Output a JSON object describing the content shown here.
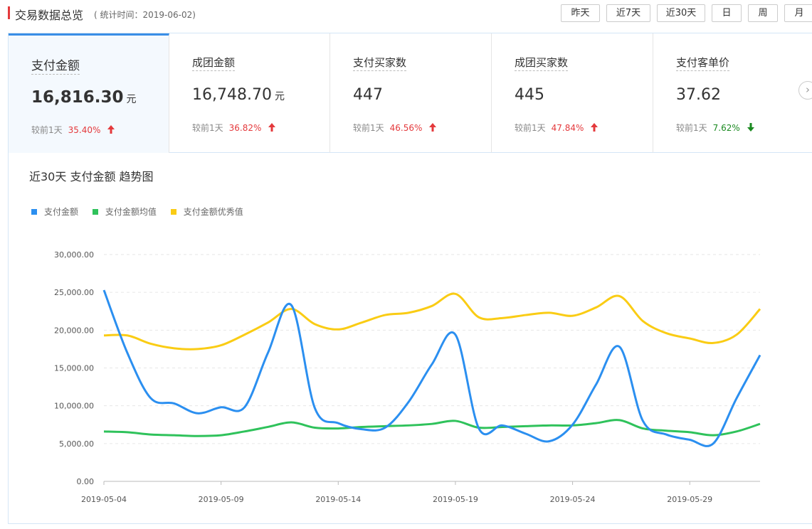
{
  "header": {
    "title": "交易数据总览",
    "subtitle": "( 统计时间：2019-06-02)"
  },
  "range_buttons": [
    {
      "label": "昨天",
      "active": true
    },
    {
      "label": "近7天",
      "active": false
    },
    {
      "label": "近30天",
      "active": false
    },
    {
      "label": "日",
      "active": false
    },
    {
      "label": "周",
      "active": false
    },
    {
      "label": "月",
      "active": false
    }
  ],
  "kpis": [
    {
      "name": "支付金额",
      "value": "16,816.30",
      "unit": "元",
      "compare_label": "较前1天",
      "change": "35.40%",
      "direction": "up",
      "active": true
    },
    {
      "name": "成团金额",
      "value": "16,748.70",
      "unit": "元",
      "compare_label": "较前1天",
      "change": "36.82%",
      "direction": "up",
      "active": false
    },
    {
      "name": "支付买家数",
      "value": "447",
      "unit": "",
      "compare_label": "较前1天",
      "change": "46.56%",
      "direction": "up",
      "active": false
    },
    {
      "name": "成团买家数",
      "value": "445",
      "unit": "",
      "compare_label": "较前1天",
      "change": "47.84%",
      "direction": "up",
      "active": false
    },
    {
      "name": "支付客单价",
      "value": "37.62",
      "unit": "",
      "compare_label": "较前1天",
      "change": "7.62%",
      "direction": "down",
      "active": false
    }
  ],
  "next_icon": "chevron-right-icon",
  "colors": {
    "accent": "#3a8ee6",
    "up": "#e4393c",
    "down": "#1b8a21"
  },
  "chart_data": {
    "type": "line",
    "title": "近30天 支付金额 趋势图",
    "ylim": [
      0,
      30000
    ],
    "yticks": [
      "0.00",
      "5,000.00",
      "10,000.00",
      "15,000.00",
      "20,000.00",
      "25,000.00",
      "30,000.00"
    ],
    "xticks": [
      "2019-05-04",
      "2019-05-09",
      "2019-05-14",
      "2019-05-19",
      "2019-05-24",
      "2019-05-29"
    ],
    "x": [
      "2019-05-04",
      "2019-05-05",
      "2019-05-06",
      "2019-05-07",
      "2019-05-08",
      "2019-05-09",
      "2019-05-10",
      "2019-05-11",
      "2019-05-12",
      "2019-05-13",
      "2019-05-14",
      "2019-05-15",
      "2019-05-16",
      "2019-05-17",
      "2019-05-18",
      "2019-05-19",
      "2019-05-20",
      "2019-05-21",
      "2019-05-22",
      "2019-05-23",
      "2019-05-24",
      "2019-05-25",
      "2019-05-26",
      "2019-05-27",
      "2019-05-28",
      "2019-05-29",
      "2019-05-30",
      "2019-05-31",
      "2019-06-01"
    ],
    "grid": true,
    "legend_position": "top-left",
    "series": [
      {
        "name": "支付金额",
        "color": "#2b8ff0",
        "values": [
          25300,
          17000,
          11000,
          10300,
          9000,
          9800,
          9800,
          17000,
          23300,
          9700,
          7700,
          6900,
          7100,
          10500,
          15500,
          19400,
          7000,
          7400,
          6300,
          5300,
          7500,
          12800,
          17800,
          8000,
          6200,
          5500,
          5000,
          11000,
          16700
        ]
      },
      {
        "name": "支付金额均值",
        "color": "#2fc25b",
        "values": [
          6600,
          6500,
          6200,
          6100,
          6000,
          6100,
          6600,
          7200,
          7800,
          7100,
          7000,
          7200,
          7300,
          7400,
          7600,
          8000,
          7100,
          7200,
          7300,
          7400,
          7400,
          7700,
          8100,
          7000,
          6700,
          6500,
          6100,
          6600,
          7600
        ]
      },
      {
        "name": "支付金额优秀值",
        "color": "#facc14",
        "values": [
          19300,
          19300,
          18200,
          17600,
          17500,
          18000,
          19400,
          21000,
          22800,
          20800,
          20100,
          21000,
          22000,
          22300,
          23200,
          24800,
          21700,
          21600,
          22000,
          22300,
          21900,
          23000,
          24500,
          21200,
          19600,
          18900,
          18300,
          19400,
          22800
        ]
      }
    ]
  }
}
